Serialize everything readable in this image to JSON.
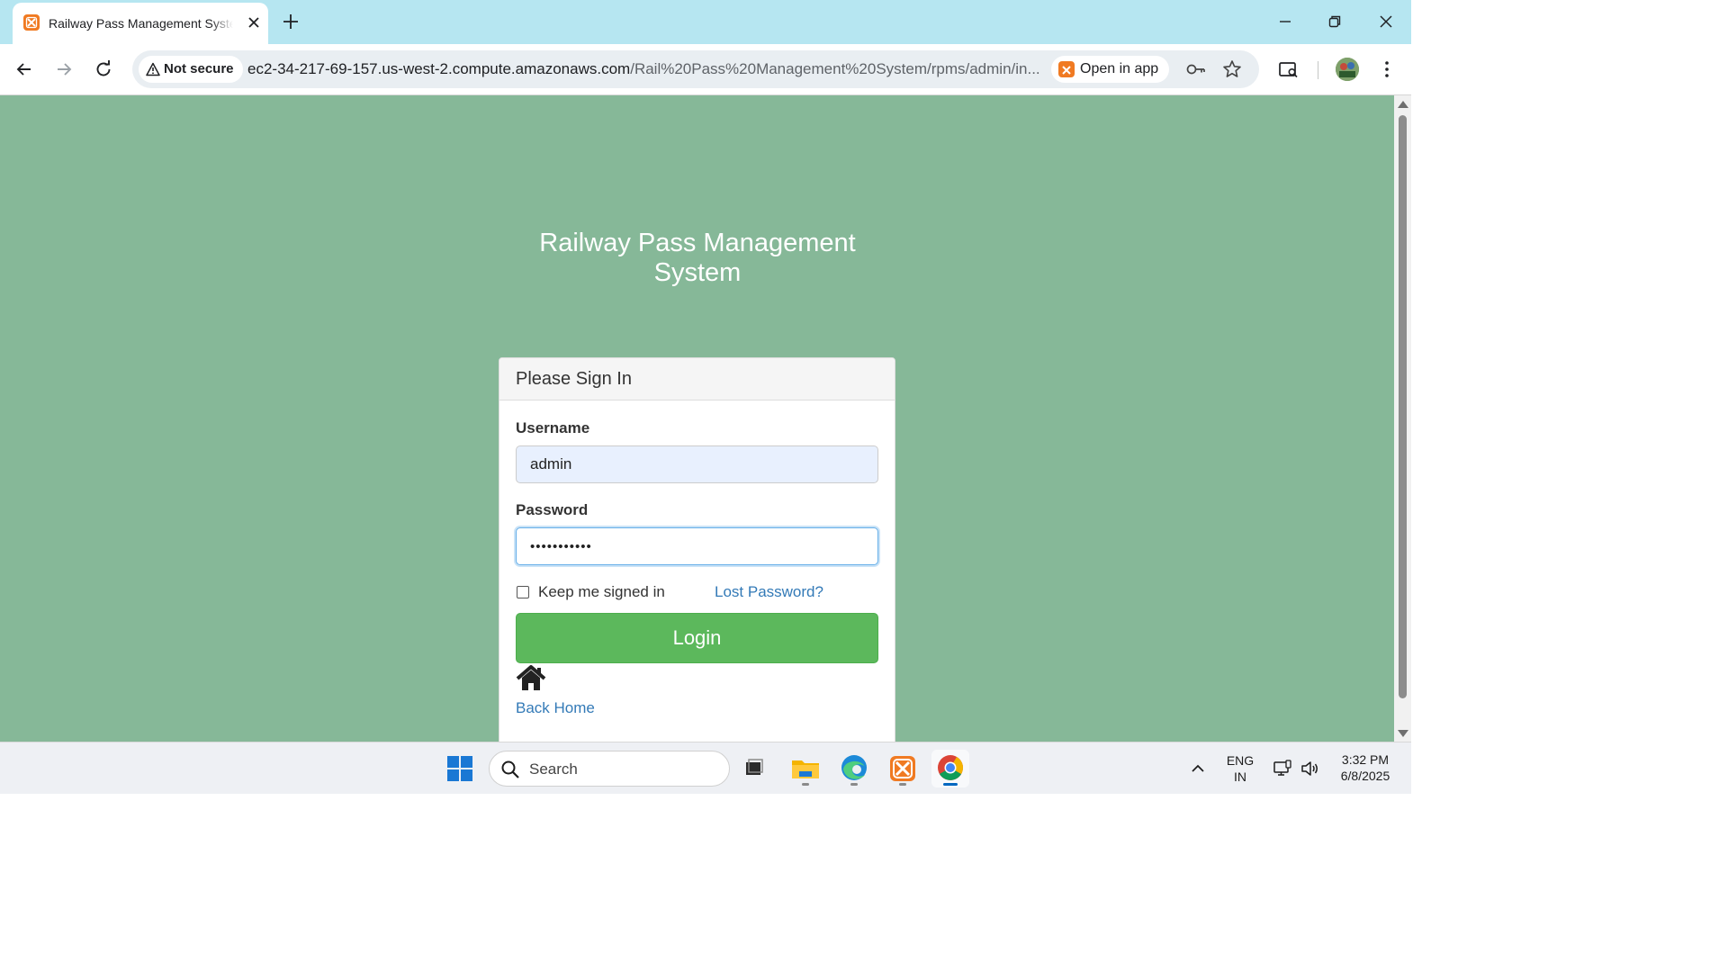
{
  "browser": {
    "tab_title": "Railway Pass Management System",
    "security_label": "Not secure",
    "url_host": "ec2-34-217-69-157.us-west-2.compute.amazonaws.com",
    "url_path": "/Rail%20Pass%20Management%20System/rpms/admin/in...",
    "open_in_app_label": "Open in app"
  },
  "page": {
    "title": "Railway Pass Management System",
    "panel_heading": "Please Sign In",
    "username_label": "Username",
    "username_value": "admin",
    "password_label": "Password",
    "password_value": "•••••••••••",
    "remember_label": "Keep me signed in",
    "lost_password_link": "Lost Password?",
    "login_button": "Login",
    "back_home_link": "Back Home",
    "background_color": "#86b898",
    "login_button_color": "#5cb85c",
    "link_color": "#337ab7"
  },
  "taskbar": {
    "search_label": "Search",
    "language_line1": "ENG",
    "language_line2": "IN",
    "time": "3:32 PM",
    "date": "6/8/2025"
  }
}
